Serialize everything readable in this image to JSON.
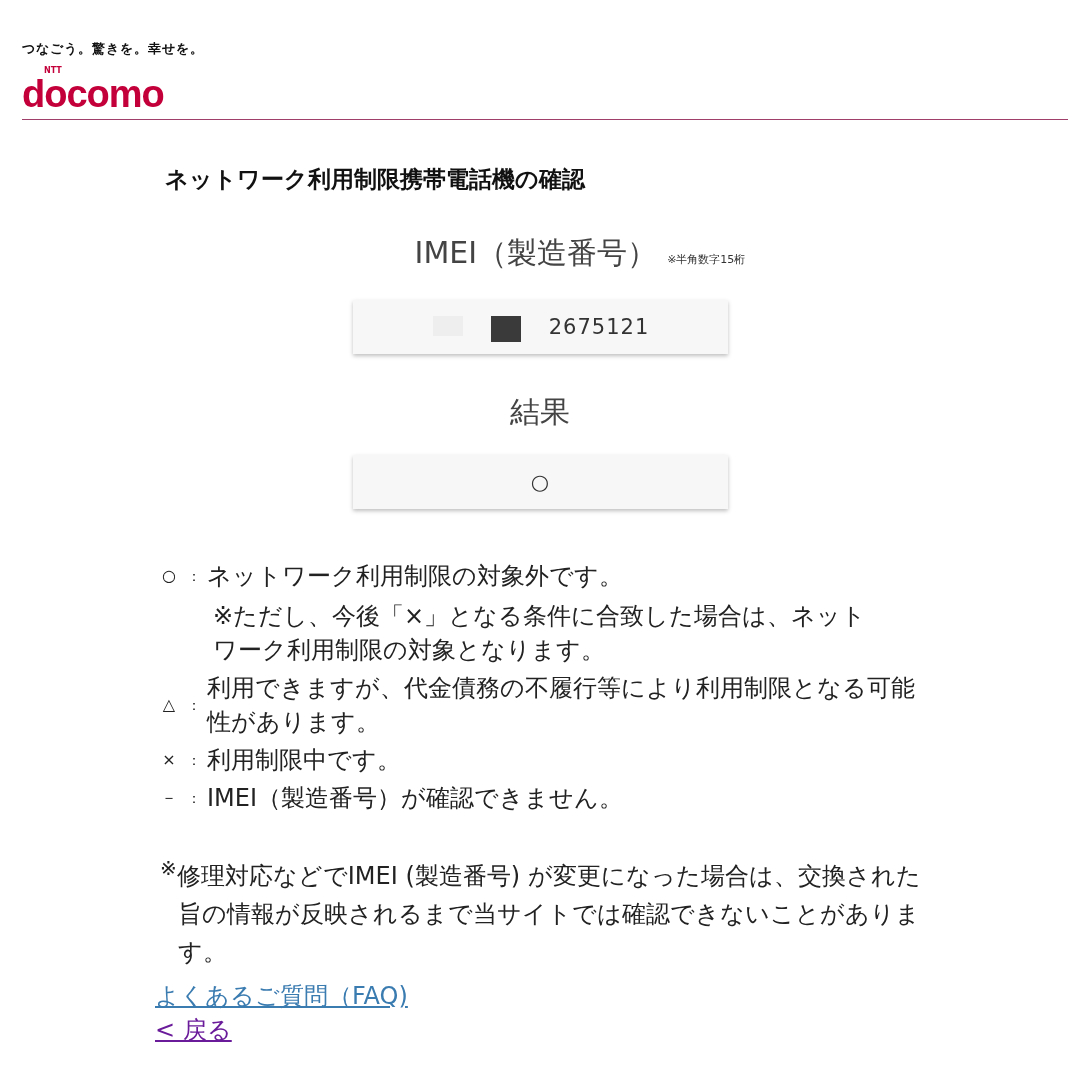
{
  "header": {
    "tagline": "つなごう。驚きを。幸せを。",
    "logo_small": "NTT",
    "logo": "docomo"
  },
  "title": "ネットワーク利用制限携帯電話機の確認",
  "imei": {
    "label": "IMEI（製造番号）",
    "hint": "※半角数字15桁",
    "value": "2675121",
    "redacted": true
  },
  "result": {
    "label": "結果",
    "value": "○"
  },
  "legend": [
    {
      "symbol": "○",
      "text": "ネットワーク利用制限の対象外です。",
      "note": "※ただし、今後「×」となる条件に合致した場合は、ネットワーク利用制限の対象となります。"
    },
    {
      "symbol": "△",
      "text": "利用できますが、代金債務の不履行等により利用制限となる可能性があります。"
    },
    {
      "symbol": "×",
      "text": "利用制限中です。"
    },
    {
      "symbol": "－",
      "text": "IMEI（製造番号）が確認できません。"
    }
  ],
  "colon": "：",
  "footnote": "$^{※}$修理対応などでIMEI (製造番号) が変更になった場合は、交換された旨の情報が反映されるまで当サイトでは確認できないことがあります。",
  "links": [
    {
      "label": "よくあるご質問（FAQ)",
      "visited": false
    },
    {
      "label": "< 戻る",
      "visited": true
    }
  ]
}
